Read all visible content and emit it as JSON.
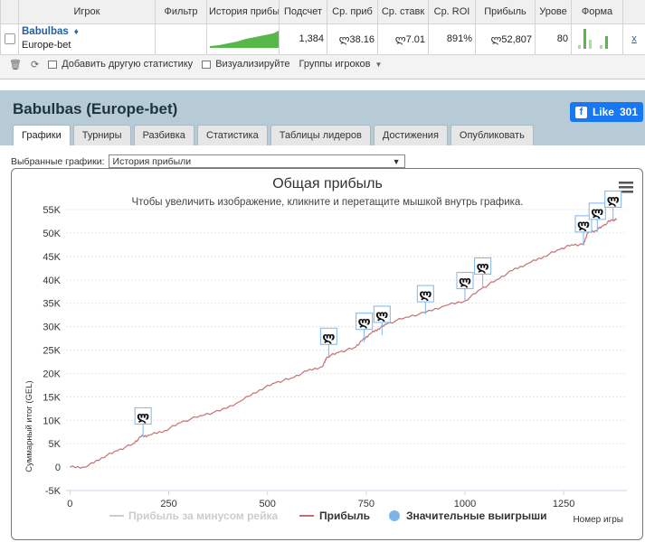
{
  "table": {
    "headers": [
      "Игрок",
      "Фильтр",
      "История прибыли",
      "Подсчет",
      "Ср. приб",
      "Ср. ставк",
      "Ср. ROI",
      "Прибыль",
      "Урове",
      "Форма"
    ],
    "row": {
      "player": "Babulbas",
      "site": "Europe-bet",
      "count": "1,384",
      "avg_profit": "ლ38.16",
      "avg_stake": "ლ7.01",
      "roi": "891%",
      "profit": "ლ52,807",
      "level": "80",
      "close": "x"
    }
  },
  "toolbar": {
    "add_stat": "Добавить другую статистику",
    "visualize": "Визуализируйте",
    "groups": "Группы игроков"
  },
  "panel": {
    "title": "Babulbas (Europe-bet)",
    "like_label": "Like",
    "like_count": "301",
    "tabs": [
      "Графики",
      "Турниры",
      "Разбивка",
      "Статистика",
      "Таблицы лидеров",
      "Достижения",
      "Опубликовать"
    ],
    "active_tab": 0,
    "select_label": "Выбранные графики:",
    "select_value": "История прибыли"
  },
  "colors": {
    "profit_line": "#c67171",
    "rake_line": "#cccccc",
    "big_win_marker": "#7cb5ec",
    "facebook": "#1877f2",
    "sparkline": "#56b84a"
  },
  "chart_data": {
    "type": "line",
    "title": "Общая прибыль",
    "subtitle": "Чтобы увеличить изображение, кликните и перетащите мышкой внутрь графика.",
    "xlabel": "Номер игры",
    "ylabel": "Суммарный итог (GEL)",
    "xlim": [
      -10,
      1410
    ],
    "ylim": [
      -5000,
      55000
    ],
    "x_ticks": [
      0,
      250,
      500,
      750,
      1000,
      1250
    ],
    "x_tick_labels": [
      "0",
      "250",
      "500",
      "750",
      "1000",
      "1250"
    ],
    "y_ticks": [
      -5000,
      0,
      5000,
      10000,
      15000,
      20000,
      25000,
      30000,
      35000,
      40000,
      45000,
      50000,
      55000
    ],
    "y_tick_labels": [
      "-5K",
      "0",
      "5K",
      "10K",
      "15K",
      "20K",
      "25K",
      "30K",
      "35K",
      "40K",
      "45K",
      "50K",
      "55K"
    ],
    "grid": true,
    "legend": "bottom-center",
    "series": [
      {
        "name": "Прибыль за минусом рейка",
        "color": "#cccccc",
        "hidden": true,
        "x": [],
        "y": []
      },
      {
        "name": "Прибыль",
        "color": "#c67171",
        "x": [
          0,
          40,
          80,
          120,
          160,
          180,
          200,
          240,
          280,
          330,
          380,
          430,
          480,
          520,
          560,
          600,
          640,
          650,
          680,
          720,
          740,
          760,
          780,
          800,
          850,
          900,
          950,
          1000,
          1040,
          1080,
          1120,
          1160,
          1200,
          1240,
          1270,
          1300,
          1310,
          1330,
          1350,
          1370,
          1384
        ],
        "y": [
          0,
          0,
          2000,
          3500,
          5000,
          6500,
          6800,
          7800,
          9500,
          11000,
          12000,
          14000,
          16500,
          18000,
          19000,
          20500,
          21500,
          23500,
          24500,
          25500,
          27000,
          28500,
          29500,
          30500,
          32000,
          33000,
          34500,
          35500,
          38000,
          40000,
          42000,
          43500,
          45000,
          46500,
          47500,
          47500,
          50000,
          50500,
          51500,
          52800,
          52800
        ]
      },
      {
        "name": "Значительные выигрыши",
        "color": "#7cb5ec",
        "marker_symbol": "ლ",
        "x": [
          185,
          655,
          745,
          790,
          900,
          1000,
          1045,
          1300,
          1335,
          1375
        ],
        "y": [
          6500,
          23500,
          26700,
          28200,
          32600,
          35400,
          38500,
          47500,
          50200,
          52800
        ]
      }
    ]
  }
}
